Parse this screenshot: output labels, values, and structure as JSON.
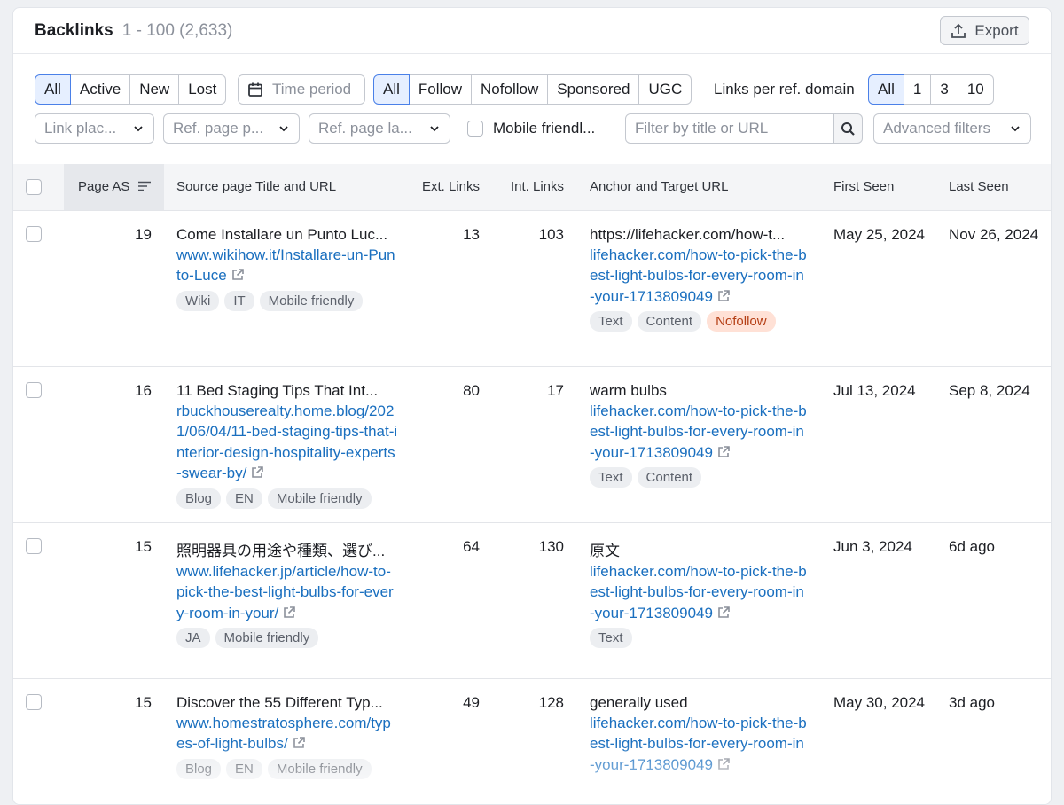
{
  "header": {
    "title": "Backlinks",
    "range": "1 - 100 (2,633)",
    "export_label": "Export"
  },
  "filters": {
    "status": [
      "All",
      "Active",
      "New",
      "Lost"
    ],
    "time_period": "Time period",
    "follow": [
      "All",
      "Follow",
      "Nofollow",
      "Sponsored",
      "UGC"
    ],
    "lprd_label": "Links per ref. domain",
    "lprd": [
      "All",
      "1",
      "3",
      "10"
    ],
    "link_placement": "Link plac...",
    "ref_page_p": "Ref. page p...",
    "ref_page_la": "Ref. page la...",
    "mobile_friendly": "Mobile friendl...",
    "search_placeholder": "Filter by title or URL",
    "advanced": "Advanced filters"
  },
  "columns": {
    "page_as": "Page AS",
    "source": "Source page Title and URL",
    "ext": "Ext. Links",
    "int": "Int. Links",
    "anchor": "Anchor and Target URL",
    "first": "First Seen",
    "last": "Last Seen"
  },
  "rows": [
    {
      "as": "19",
      "title": "Come Installare un Punto Luc...",
      "url": "www.wikihow.it/Installare-un-Punto-Luce",
      "tags": [
        "Wiki",
        "IT",
        "Mobile friendly"
      ],
      "ext": "13",
      "int": "103",
      "anchor": "https://lifehacker.com/how-t...",
      "target": "lifehacker.com/how-to-pick-the-best-light-bulbs-for-every-room-in-your-1713809049",
      "anchor_tags": [
        "Text",
        "Content",
        "Nofollow"
      ],
      "first": "May 25, 2024",
      "last": "Nov 26, 2024"
    },
    {
      "as": "16",
      "title": "11 Bed Staging Tips That Int...",
      "url": "rbuckhouserealty.home.blog/2021/06/04/11-bed-staging-tips-that-interior-design-hospitality-experts-swear-by/",
      "tags": [
        "Blog",
        "EN",
        "Mobile friendly"
      ],
      "ext": "80",
      "int": "17",
      "anchor": "warm bulbs",
      "target": "lifehacker.com/how-to-pick-the-best-light-bulbs-for-every-room-in-your-1713809049",
      "anchor_tags": [
        "Text",
        "Content"
      ],
      "first": "Jul 13, 2024",
      "last": "Sep 8, 2024"
    },
    {
      "as": "15",
      "title": "照明器具の用途や種類、選び...",
      "url": "www.lifehacker.jp/article/how-to-pick-the-best-light-bulbs-for-every-room-in-your/",
      "tags": [
        "JA",
        "Mobile friendly"
      ],
      "ext": "64",
      "int": "130",
      "anchor": "原文",
      "target": "lifehacker.com/how-to-pick-the-best-light-bulbs-for-every-room-in-your-1713809049",
      "anchor_tags": [
        "Text"
      ],
      "first": "Jun 3, 2024",
      "last": "6d ago"
    },
    {
      "as": "15",
      "title": "Discover the 55 Different Typ...",
      "url": "www.homestratosphere.com/types-of-light-bulbs/",
      "tags": [
        "Blog",
        "EN",
        "Mobile friendly"
      ],
      "ext": "49",
      "int": "128",
      "anchor": "generally used",
      "target": "lifehacker.com/how-to-pick-the-best-light-bulbs-for-every-room-in-your-1713809049",
      "anchor_tags": [],
      "first": "May 30, 2024",
      "last": "3d ago"
    }
  ]
}
